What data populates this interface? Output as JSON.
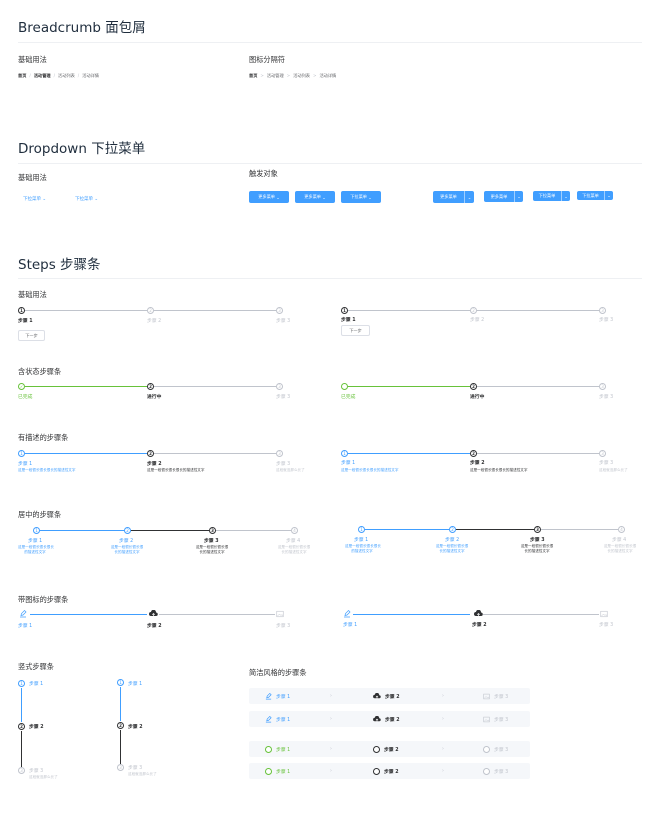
{
  "breadcrumb": {
    "title": "Breadcrumb 面包屑",
    "basic": {
      "heading": "基础用法",
      "items": [
        "首页",
        "活动管理",
        "活动列表",
        "活动详情"
      ],
      "separator": "/"
    },
    "icon_sep": {
      "heading": "图标分隔符",
      "items": [
        "首页",
        "活动管理",
        "活动列表",
        "活动详情"
      ],
      "separator": ">"
    }
  },
  "dropdown": {
    "title": "Dropdown 下拉菜单",
    "basic": {
      "heading": "基础用法",
      "items": [
        "下拉菜单",
        "下拉菜单"
      ]
    },
    "trigger": {
      "heading": "触发对象",
      "buttons": [
        "更多菜单",
        "更多菜单",
        "下拉菜单",
        "更多菜单",
        "更多菜单",
        "下拉菜单",
        "下拉菜单"
      ]
    }
  },
  "steps": {
    "title": "Steps 步骤条",
    "basic": {
      "heading": "基础用法",
      "left": {
        "steps": [
          {
            "num": "1",
            "title": "步骤 1"
          },
          {
            "num": "2",
            "title": "步骤 2"
          },
          {
            "num": "3",
            "title": "步骤 3"
          }
        ],
        "next": "下一步"
      },
      "right": {
        "steps": [
          {
            "num": "1",
            "title": "步骤 1"
          },
          {
            "num": "2",
            "title": "步骤 2"
          },
          {
            "num": "3",
            "title": "步骤 3"
          }
        ],
        "next": "下一步"
      }
    },
    "status": {
      "heading": "含状态步骤条",
      "steps": [
        {
          "num": "✓",
          "title": "已完成"
        },
        {
          "num": "2",
          "title": "进行中"
        },
        {
          "num": "3",
          "title": "步骤 3"
        }
      ]
    },
    "described": {
      "heading": "有描述的步骤条",
      "steps": [
        {
          "num": "1",
          "title": "步骤 1",
          "desc": "这是一段很长很长很长的描述性文字"
        },
        {
          "num": "2",
          "title": "步骤 2",
          "desc": "这是一段很长很长很长的描述性文字"
        },
        {
          "num": "3",
          "title": "步骤 3",
          "desc": "这段就没那么长了"
        }
      ]
    },
    "centered": {
      "heading": "居中的步骤条",
      "steps": [
        {
          "num": "1",
          "title": "步骤 1",
          "desc1": "这是一段很长很长很长",
          "desc2": "的描述性文字"
        },
        {
          "num": "2",
          "title": "步骤 2",
          "desc1": "这是一段很长很长很",
          "desc2": "长的描述性文字"
        },
        {
          "num": "3",
          "title": "步骤 3",
          "desc1": "这是一段很长很长很",
          "desc2": "长的描述性文字"
        },
        {
          "num": "4",
          "title": "步骤 4",
          "desc1": "这是一段很长很长很",
          "desc2": "长的描述性文字"
        }
      ]
    },
    "with_icon": {
      "heading": "带图标的步骤条",
      "steps": [
        {
          "icon": "edit-icon",
          "title": "步骤 1"
        },
        {
          "icon": "upload-icon",
          "title": "步骤 2"
        },
        {
          "icon": "picture-icon",
          "title": "步骤 3"
        }
      ]
    },
    "vertical": {
      "heading": "竖式步骤条",
      "steps": [
        {
          "num": "1",
          "title": "步骤 1"
        },
        {
          "num": "2",
          "title": "步骤 2"
        },
        {
          "num": "3",
          "title": "步骤 3",
          "desc": "这段就没那么长了"
        }
      ]
    },
    "simple": {
      "heading": "简洁风格的步骤条",
      "rows": [
        [
          {
            "title": "步骤 1"
          },
          {
            "title": "步骤 2"
          },
          {
            "title": "步骤 3"
          }
        ],
        [
          {
            "title": "步骤 1"
          },
          {
            "title": "步骤 2"
          },
          {
            "title": "步骤 3"
          }
        ],
        [
          {
            "title": "步骤 1"
          },
          {
            "title": "步骤 2"
          },
          {
            "title": "步骤 3"
          }
        ],
        [
          {
            "title": "步骤 1"
          },
          {
            "title": "步骤 2"
          },
          {
            "title": "步骤 3"
          }
        ]
      ]
    }
  },
  "colors": {
    "primary": "#409eff",
    "success": "#67c23a",
    "wait": "#c0c4cc",
    "text": "#303133"
  }
}
